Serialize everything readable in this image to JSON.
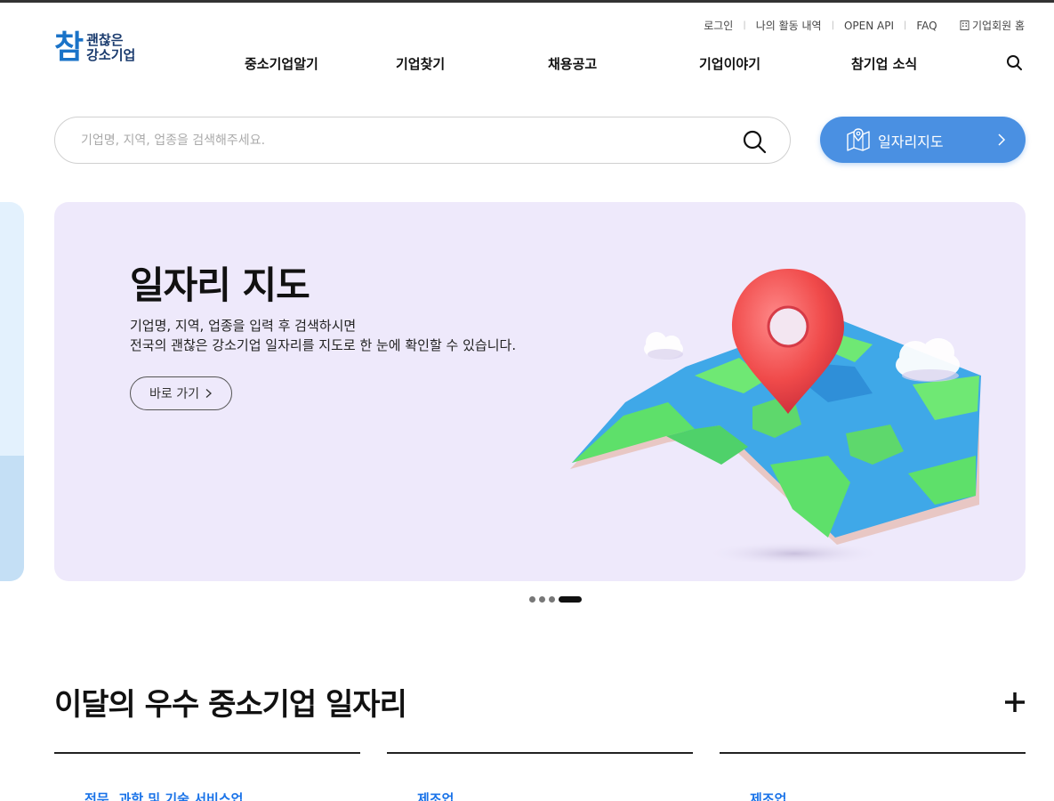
{
  "utility_nav": {
    "login": "로그인",
    "my_activity": "나의 활동 내역",
    "open_api": "OPEN API",
    "faq": "FAQ",
    "corporate_home": "기업회원 홈"
  },
  "logo": {
    "mark": "참",
    "line1": "괜찮은",
    "line2": "강소기업"
  },
  "gnb": {
    "items": [
      "중소기업알기",
      "기업찾기",
      "채용공고",
      "기업이야기",
      "참기업 소식"
    ]
  },
  "search": {
    "placeholder": "기업명, 지역, 업종을 검색해주세요.",
    "map_button_label": "일자리지도"
  },
  "hero": {
    "title": "일자리 지도",
    "desc_line1": "기업명, 지역, 업종을 입력 후 검색하시면",
    "desc_line2": "전국의 괜찮은 강소기업 일자리를 지도로 한 눈에 확인할 수 있습니다.",
    "cta_label": "바로 가기",
    "slide_count": 4,
    "active_slide": 4
  },
  "section": {
    "title": "이달의 우수 중소기업 일자리",
    "cards": [
      {
        "category": "전문, 과학 및 기술 서비스업"
      },
      {
        "category": "제조업"
      },
      {
        "category": "제조업"
      }
    ]
  },
  "colors": {
    "brand_blue": "#1a73c8",
    "map_button": "#4a90e2",
    "hero_bg": "#eee9fb",
    "category_blue": "#1a73e8"
  }
}
